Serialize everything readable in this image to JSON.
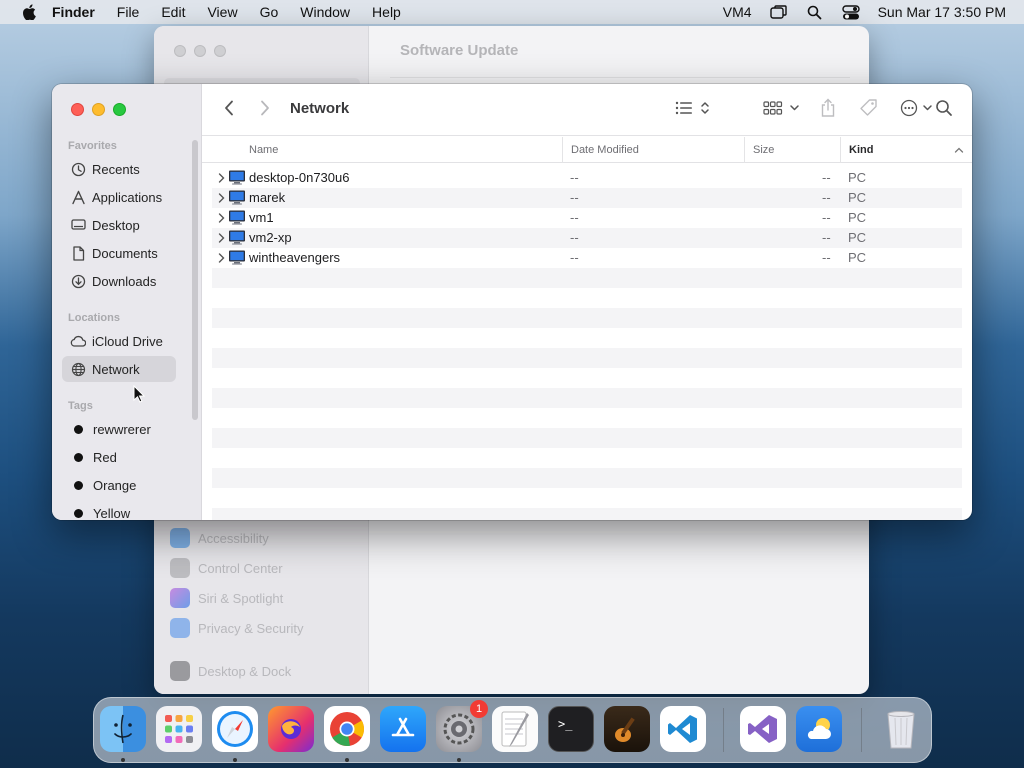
{
  "menubar": {
    "app_name": "Finder",
    "items": [
      "File",
      "Edit",
      "View",
      "Go",
      "Window",
      "Help"
    ],
    "status_label": "VM4",
    "datetime": "Sun Mar 17  3:50 PM"
  },
  "settings_window": {
    "title": "Software Update",
    "items": [
      {
        "label": "Accessibility",
        "color": "#4a90e2"
      },
      {
        "label": "Control Center",
        "color": "#8e8e93"
      },
      {
        "label": "Siri & Spotlight",
        "color": "#b45fd6"
      },
      {
        "label": "Privacy & Security",
        "color": "#3a7bd5"
      },
      {
        "label": "Desktop & Dock",
        "color": "#1c1c1e"
      }
    ]
  },
  "finder": {
    "title": "Network",
    "sidebar": {
      "favorites_header": "Favorites",
      "favorites": [
        {
          "label": "Recents",
          "icon": "clock-icon"
        },
        {
          "label": "Applications",
          "icon": "applications-icon"
        },
        {
          "label": "Desktop",
          "icon": "desktop-icon"
        },
        {
          "label": "Documents",
          "icon": "document-icon"
        },
        {
          "label": "Downloads",
          "icon": "download-icon"
        }
      ],
      "locations_header": "Locations",
      "locations": [
        {
          "label": "iCloud Drive",
          "icon": "cloud-icon"
        },
        {
          "label": "Network",
          "icon": "globe-icon",
          "selected": true
        }
      ],
      "tags_header": "Tags",
      "tags": [
        {
          "label": "rewwrerer"
        },
        {
          "label": "Red"
        },
        {
          "label": "Orange"
        },
        {
          "label": "Yellow"
        }
      ]
    },
    "columns": {
      "name": "Name",
      "date_modified": "Date Modified",
      "size": "Size",
      "kind": "Kind"
    },
    "rows": [
      {
        "name": "desktop-0n730u6",
        "date": "--",
        "size": "--",
        "kind": "PC"
      },
      {
        "name": "marek",
        "date": "--",
        "size": "--",
        "kind": "PC"
      },
      {
        "name": "vm1",
        "date": "--",
        "size": "--",
        "kind": "PC"
      },
      {
        "name": "vm2-xp",
        "date": "--",
        "size": "--",
        "kind": "PC"
      },
      {
        "name": "wintheavengers",
        "date": "--",
        "size": "--",
        "kind": "PC"
      }
    ]
  },
  "dock": {
    "apps": [
      {
        "name": "finder-icon",
        "running": true
      },
      {
        "name": "launchpad-icon",
        "running": false
      },
      {
        "name": "safari-icon",
        "running": true
      },
      {
        "name": "firefox-icon",
        "running": false
      },
      {
        "name": "chrome-icon",
        "running": true
      },
      {
        "name": "app-store-icon",
        "running": false
      },
      {
        "name": "system-settings-icon",
        "running": true,
        "badge": "1"
      },
      {
        "name": "textedit-icon",
        "running": false
      },
      {
        "name": "terminal-icon",
        "running": false
      },
      {
        "name": "garageband-icon",
        "running": false
      },
      {
        "name": "vscode-icon",
        "running": false
      },
      {
        "name": "visual-studio-icon",
        "running": false
      },
      {
        "name": "weather-icon",
        "running": false
      },
      {
        "name": "trash-icon",
        "running": false
      }
    ]
  }
}
